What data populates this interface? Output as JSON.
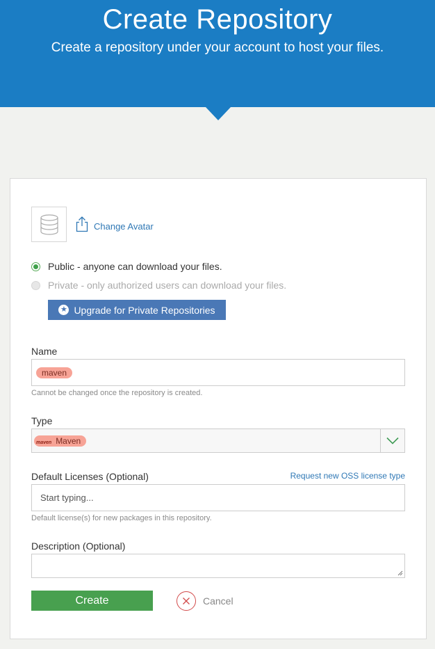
{
  "header": {
    "title": "Create Repository",
    "subtitle": "Create a repository under your account to host your files."
  },
  "avatar": {
    "change_label": "Change Avatar"
  },
  "visibility": {
    "public_label": "Public - anyone can download your files.",
    "private_label": "Private - only authorized users can download your files.",
    "upgrade_label": "Upgrade for Private Repositories"
  },
  "name": {
    "label": "Name",
    "value": "maven",
    "help": "Cannot be changed once the repository is created."
  },
  "type": {
    "label": "Type",
    "icon_text": "maven",
    "value": "Maven"
  },
  "licenses": {
    "label": "Default Licenses (Optional)",
    "request_link": "Request new OSS license type",
    "placeholder": "Start typing...",
    "help": "Default license(s) for new packages in this repository."
  },
  "description": {
    "label": "Description (Optional)",
    "value": ""
  },
  "actions": {
    "create_label": "Create",
    "cancel_label": "Cancel"
  },
  "colors": {
    "header": "#1b7dc4",
    "create": "#48a04f",
    "upgrade": "#4a78b6",
    "tag": "#f7a396",
    "cancel_icon": "#d24a4a"
  }
}
